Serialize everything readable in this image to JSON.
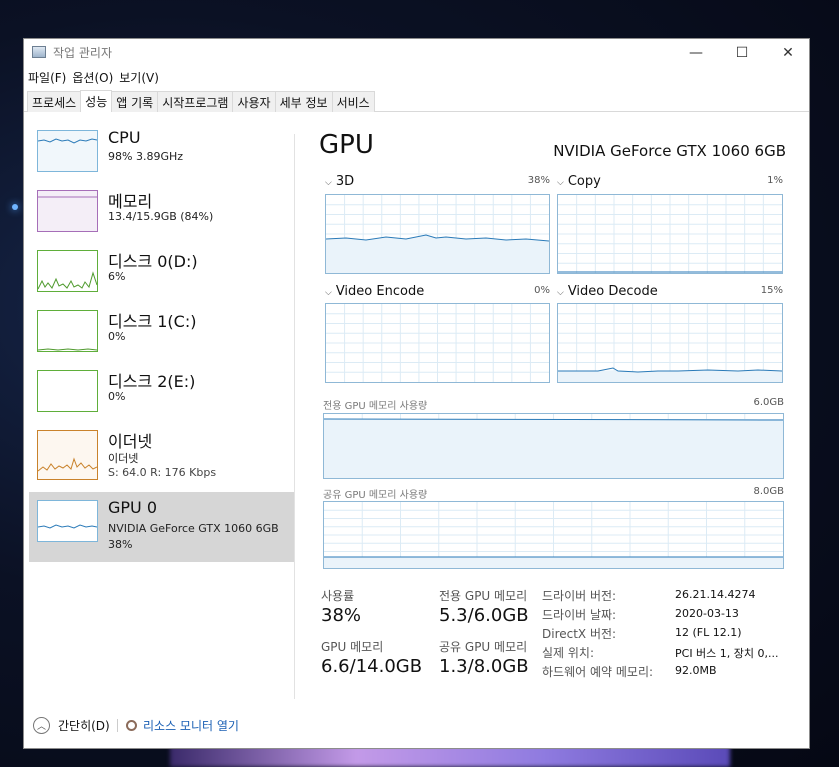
{
  "window": {
    "title": "작업 관리자",
    "min_icon": "—",
    "max_icon": "☐",
    "close_icon": "✕"
  },
  "menu": [
    "파일(F)",
    "옵션(O)",
    "보기(V)"
  ],
  "tabs": [
    "프로세스",
    "성능",
    "앱 기록",
    "시작프로그램",
    "사용자",
    "세부 정보",
    "서비스"
  ],
  "active_tab": "성능",
  "sidebar": [
    {
      "title": "CPU",
      "sub1": "98% 3.89GHz",
      "sub2": "",
      "color": "#7eb6da"
    },
    {
      "title": "메모리",
      "sub1": "13.4/15.9GB (84%)",
      "sub2": "",
      "color": "#a66eb8"
    },
    {
      "title": "디스크 0(D:)",
      "sub1": "6%",
      "sub2": "",
      "color": "#5fae3a"
    },
    {
      "title": "디스크 1(C:)",
      "sub1": "0%",
      "sub2": "",
      "color": "#5fae3a"
    },
    {
      "title": "디스크 2(E:)",
      "sub1": "0%",
      "sub2": "",
      "color": "#5fae3a"
    },
    {
      "title": "이더넷",
      "sub1": "이더넷",
      "sub2": "S: 64.0  R: 176 Kbps",
      "color": "#c9822b"
    },
    {
      "title": "GPU 0",
      "sub1": "NVIDIA GeForce GTX 1060 6GB",
      "sub2": "38%",
      "color": "#7eb6da"
    }
  ],
  "gpu": {
    "title": "GPU",
    "model": "NVIDIA GeForce GTX 1060 6GB",
    "engines": [
      {
        "name": "3D",
        "pct": "38%"
      },
      {
        "name": "Copy",
        "pct": "1%"
      },
      {
        "name": "Video Encode",
        "pct": "0%"
      },
      {
        "name": "Video Decode",
        "pct": "15%"
      }
    ],
    "dedicated_label": "전용 GPU 메모리 사용량",
    "dedicated_cap": "6.0GB",
    "shared_label": "공유 GPU 메모리 사용량",
    "shared_cap": "8.0GB"
  },
  "stats": {
    "usage_label": "사용률",
    "usage_value": "38%",
    "dedicated_label": "전용 GPU 메모리",
    "dedicated_value": "5.3/6.0GB",
    "gpu_mem_label": "GPU 메모리",
    "gpu_mem_value": "6.6/14.0GB",
    "shared_label": "공유 GPU 메모리",
    "shared_value": "1.3/8.0GB"
  },
  "info": [
    {
      "key": "드라이버 버전:",
      "value": "26.21.14.4274"
    },
    {
      "key": "드라이버 날짜:",
      "value": "2020-03-13"
    },
    {
      "key": "DirectX 버전:",
      "value": "12 (FL 12.1)"
    },
    {
      "key": "실제 위치:",
      "value": "PCI 버스 1, 장치 0,..."
    },
    {
      "key": "하드웨어 예약 메모리:",
      "value": "92.0MB"
    }
  ],
  "footer": {
    "collapse": "간단히(D)",
    "resmon": "리소스 모니터 열기"
  }
}
